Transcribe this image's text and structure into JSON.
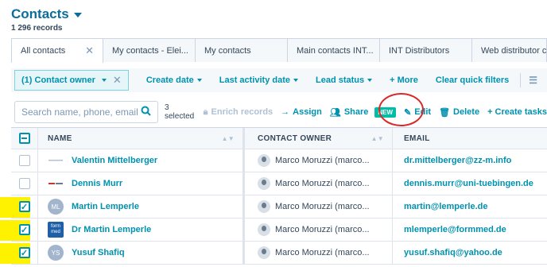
{
  "header": {
    "title": "Contacts",
    "record_count": "1 296 records"
  },
  "tabs": [
    {
      "label": "All contacts",
      "close": "✕"
    },
    {
      "label": "My contacts - Elei..."
    },
    {
      "label": "My contacts"
    },
    {
      "label": "Main contacts INT..."
    },
    {
      "label": "INT Distributors"
    },
    {
      "label": "Web distributor c"
    }
  ],
  "filters": {
    "active_chip": "(1) Contact owner",
    "create_date": "Create date",
    "last_activity": "Last activity date",
    "lead_status": "Lead status",
    "more": "+ More",
    "clear": "Clear quick filters"
  },
  "actions": {
    "search_placeholder": "Search name, phone, email",
    "selected": "3 selected",
    "enrich": "Enrich records",
    "assign": "Assign",
    "share": "Share",
    "new_badge": "NEW",
    "edit": "Edit",
    "delete": "Delete",
    "create_tasks": "+ Create tasks"
  },
  "table": {
    "columns": {
      "name": "NAME",
      "owner": "CONTACT OWNER",
      "email": "EMAIL"
    },
    "rows": [
      {
        "name": "Valentin Mittelberger",
        "owner": "Marco Moruzzi (marco...",
        "email": "dr.mittelberger@zz-m.info",
        "checked": false,
        "avatar": "logo"
      },
      {
        "name": "Dennis Murr",
        "owner": "Marco Moruzzi (marco...",
        "email": "dennis.murr@uni-tuebingen.de",
        "checked": false,
        "avatar": "logo"
      },
      {
        "name": "Martin Lemperle",
        "owner": "Marco Moruzzi (marco...",
        "email": "martin@lemperle.de",
        "checked": true,
        "avatar": "ML"
      },
      {
        "name": "Dr Martin Lemperle",
        "owner": "Marco Moruzzi (marco...",
        "email": "mlemperle@formmed.de",
        "checked": true,
        "avatar": "form med"
      },
      {
        "name": "Yusuf Shafiq",
        "owner": "Marco Moruzzi (marco...",
        "email": "yusuf.shafiq@yahoo.de",
        "checked": true,
        "avatar": "YS"
      }
    ]
  },
  "colors": {
    "accent": "#0091ae",
    "title": "#0b6e99",
    "highlight": "#fff200",
    "annotation": "#d82a2a",
    "new_badge": "#00bda5"
  }
}
